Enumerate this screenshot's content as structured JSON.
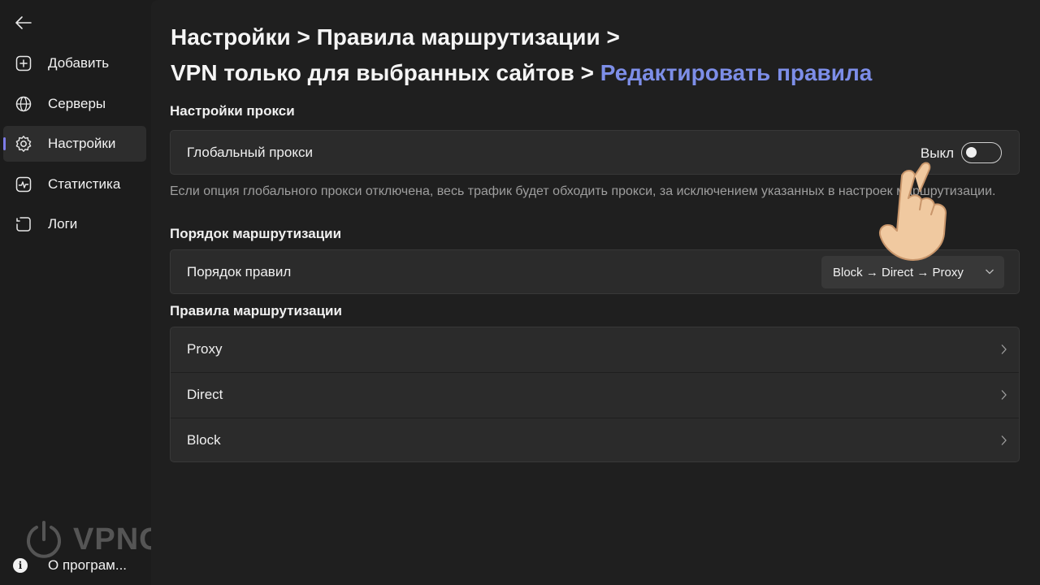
{
  "sidebar": {
    "items": [
      {
        "label": "Добавить",
        "icon": "add-square-icon"
      },
      {
        "label": "Серверы",
        "icon": "globe-icon"
      },
      {
        "label": "Настройки",
        "icon": "gear-icon",
        "active": true
      },
      {
        "label": "Статистика",
        "icon": "chart-icon"
      },
      {
        "label": "Логи",
        "icon": "log-icon"
      }
    ],
    "about_label": "О програм..."
  },
  "watermark": {
    "text": "VPNON"
  },
  "breadcrumb": {
    "part1": "Настройки",
    "sep1": " > ",
    "part2": "Правила маршрутизации",
    "sep2": " >",
    "part3": "VPN только для выбранных сайтов",
    "sep3": " > ",
    "current": "Редактировать правила"
  },
  "proxy_settings": {
    "title": "Настройки прокси",
    "global_proxy_label": "Глобальный прокси",
    "global_proxy_state": "Выкл",
    "hint": "Если опция глобального прокси отключена, весь трафик будет обходить прокси, за исключением указанных в настроек маршрутизации."
  },
  "routing_order": {
    "title": "Порядок маршрутизации",
    "label": "Порядок правил",
    "selected": "Block → Direct → Proxy"
  },
  "routing_rules": {
    "title": "Правила маршрутизации",
    "rows": [
      "Proxy",
      "Direct",
      "Block"
    ]
  },
  "colors": {
    "accent": "#7e7ce8",
    "link": "#7d8ee8",
    "background": "#1f1f1f",
    "card": "#2b2b2b"
  }
}
